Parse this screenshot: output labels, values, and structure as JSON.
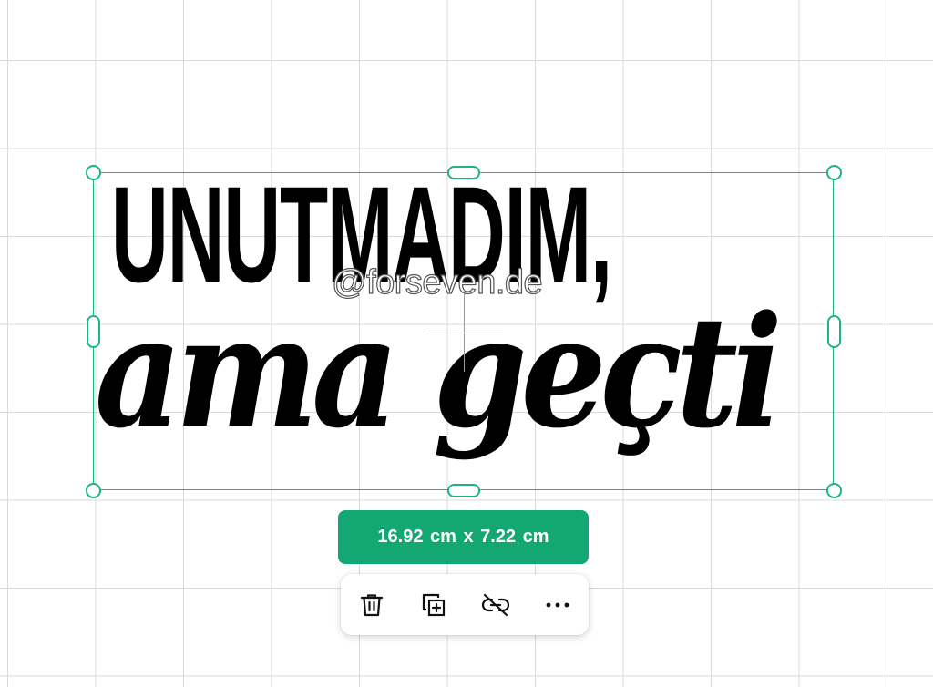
{
  "design": {
    "line1": "UNUTMADIM,",
    "line2": "ama geçti",
    "watermark": "@forseven.de"
  },
  "selection": {
    "size_label": "16.92  cm x 7.22  cm",
    "accent_color": "#1fb47f",
    "badge_color": "#13a873"
  },
  "toolbar": {
    "icons": [
      "trash-icon",
      "duplicate-icon",
      "unlink-icon",
      "more-icon"
    ]
  }
}
